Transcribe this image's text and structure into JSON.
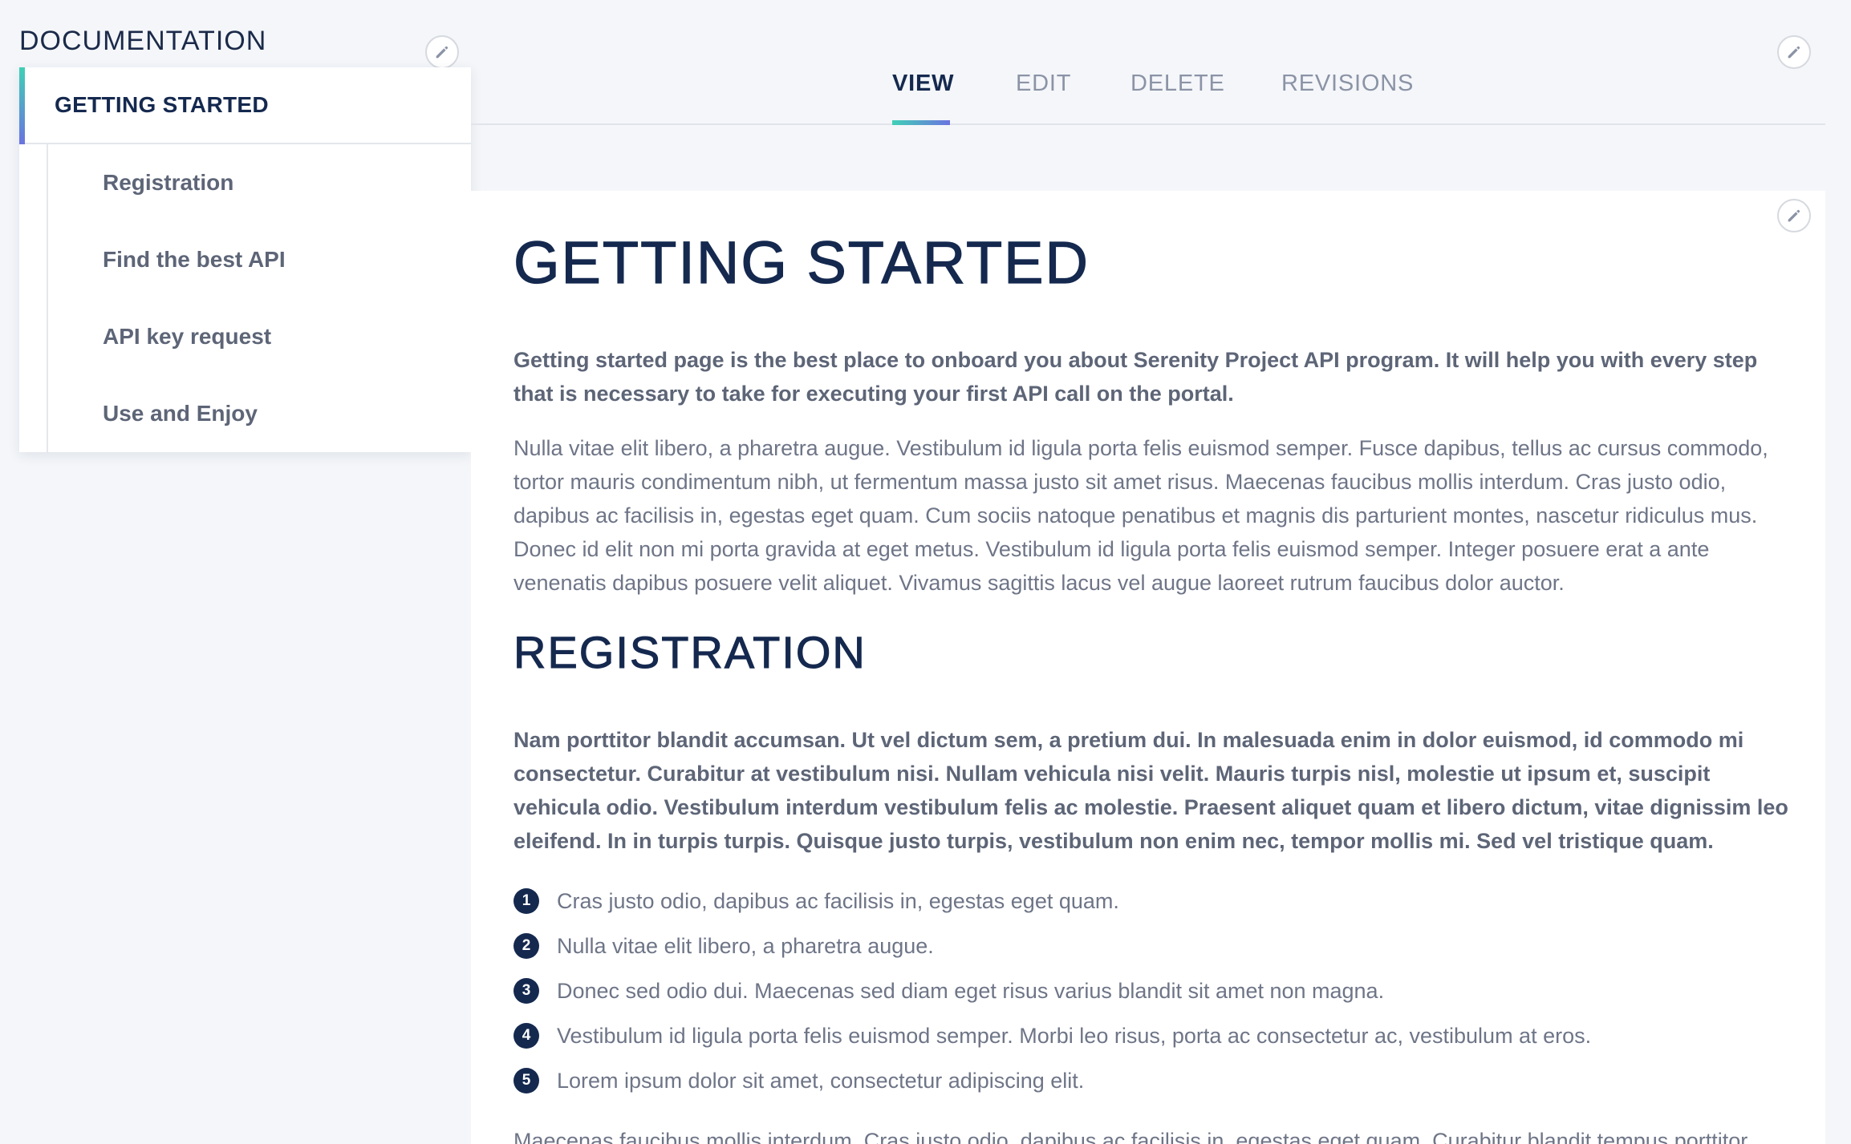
{
  "sidebar": {
    "title": "DOCUMENTATION",
    "active_item": "GETTING STARTED",
    "items": [
      {
        "label": "Registration"
      },
      {
        "label": "Find the best API"
      },
      {
        "label": "API key request"
      },
      {
        "label": "Use and Enjoy"
      }
    ]
  },
  "tabs": [
    {
      "label": "VIEW",
      "active": true
    },
    {
      "label": "EDIT",
      "active": false
    },
    {
      "label": "DELETE",
      "active": false
    },
    {
      "label": "REVISIONS",
      "active": false
    }
  ],
  "content": {
    "title": "GETTING STARTED",
    "intro_lead": "Getting started page is the best place to onboard you about Serenity Project API program. It will help you with every step that is necessary to take for executing your first API call on the portal.",
    "intro_text": "Nulla vitae elit libero, a pharetra augue. Vestibulum id ligula porta felis euismod semper. Fusce dapibus, tellus ac cursus commodo, tortor mauris condimentum nibh, ut fermentum massa justo sit amet risus. Maecenas faucibus mollis interdum. Cras justo odio, dapibus ac facilisis in, egestas eget quam. Cum sociis natoque penatibus et magnis dis parturient montes, nascetur ridiculus mus. Donec id elit non mi porta gravida at eget metus. Vestibulum id ligula porta felis euismod semper. Integer posuere erat a ante venenatis dapibus posuere velit aliquet. Vivamus sagittis lacus vel augue laoreet rutrum faucibus dolor auctor.",
    "registration_title": "REGISTRATION",
    "registration_lead": "Nam porttitor blandit accumsan. Ut vel dictum sem, a pretium dui. In malesuada enim in dolor euismod, id commodo mi consectetur. Curabitur at vestibulum nisi. Nullam vehicula nisi velit. Mauris turpis nisl, molestie ut ipsum et, suscipit vehicula odio. Vestibulum interdum vestibulum felis ac molestie. Praesent aliquet quam et libero dictum, vitae dignissim leo eleifend. In in turpis turpis. Quisque justo turpis, vestibulum non enim nec, tempor mollis mi. Sed vel tristique quam.",
    "steps": [
      {
        "num": "1",
        "text": "Cras justo odio, dapibus ac facilisis in, egestas eget quam."
      },
      {
        "num": "2",
        "text": "Nulla vitae elit libero, a pharetra augue."
      },
      {
        "num": "3",
        "text": "Donec sed odio dui. Maecenas sed diam eget risus varius blandit sit amet non magna."
      },
      {
        "num": "4",
        "text": "Vestibulum id ligula porta felis euismod semper. Morbi leo risus, porta ac consectetur ac, vestibulum at eros."
      },
      {
        "num": "5",
        "text": "Lorem ipsum dolor sit amet, consectetur adipiscing elit."
      }
    ],
    "closing_text": "Maecenas faucibus mollis interdum. Cras justo odio, dapibus ac facilisis in, egestas eget quam. Curabitur blandit tempus porttitor. Donec sed odio dui. Donec sed odio dui. Aenean eu leo quam. Pellentesque ornare sem lacinia quam venenatis vestibulum."
  },
  "icons": {
    "edit": "pencil-icon"
  },
  "colors": {
    "brand_navy": "#15294f",
    "accent_teal": "#3fd0b6",
    "accent_violet": "#6b73e0"
  }
}
